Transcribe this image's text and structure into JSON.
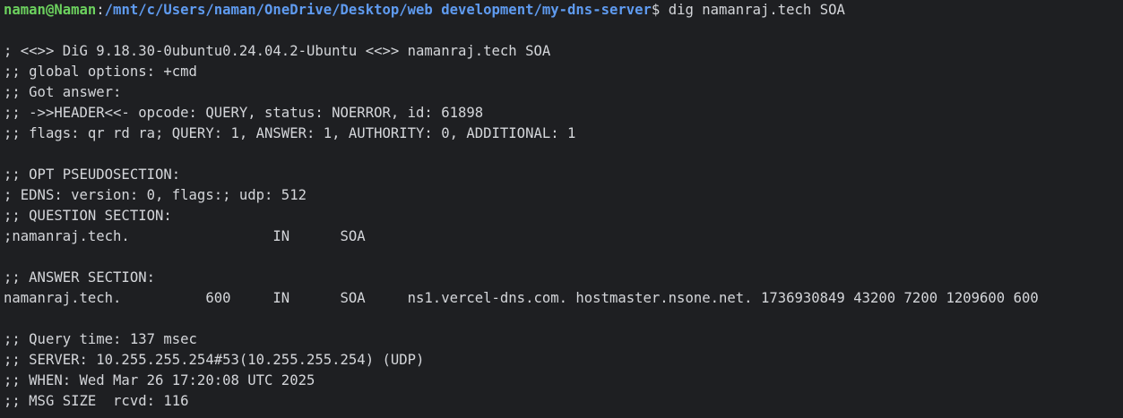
{
  "prompt": {
    "user_host": "naman@Naman",
    "separator": ":",
    "path": "/mnt/c/Users/naman/OneDrive/Desktop/web development/my-dns-server",
    "symbol": "$ ",
    "command": "dig namanraj.tech SOA"
  },
  "output": {
    "header_lines": [
      "; <<>> DiG 9.18.30-0ubuntu0.24.04.2-Ubuntu <<>> namanraj.tech SOA",
      ";; global options: +cmd",
      ";; Got answer:",
      ";; ->>HEADER<<- opcode: QUERY, status: NOERROR, id: 61898",
      ";; flags: qr rd ra; QUERY: 1, ANSWER: 1, AUTHORITY: 0, ADDITIONAL: 1"
    ],
    "opt_lines": [
      ";; OPT PSEUDOSECTION:",
      "; EDNS: version: 0, flags:; udp: 512",
      ";; QUESTION SECTION:",
      ";namanraj.tech.                 IN      SOA"
    ],
    "answer_lines": [
      ";; ANSWER SECTION:",
      "namanraj.tech.          600     IN      SOA     ns1.vercel-dns.com. hostmaster.nsone.net. 1736930849 43200 7200 1209600 600"
    ],
    "stats_lines": [
      ";; Query time: 137 msec",
      ";; SERVER: 10.255.255.254#53(10.255.255.254) (UDP)",
      ";; WHEN: Wed Mar 26 17:20:08 UTC 2025",
      ";; MSG SIZE  rcvd: 116"
    ]
  },
  "colors": {
    "background": "#1e1f22",
    "text": "#d4d6da",
    "user_host": "#6cd15e",
    "path": "#5f9bf0"
  }
}
